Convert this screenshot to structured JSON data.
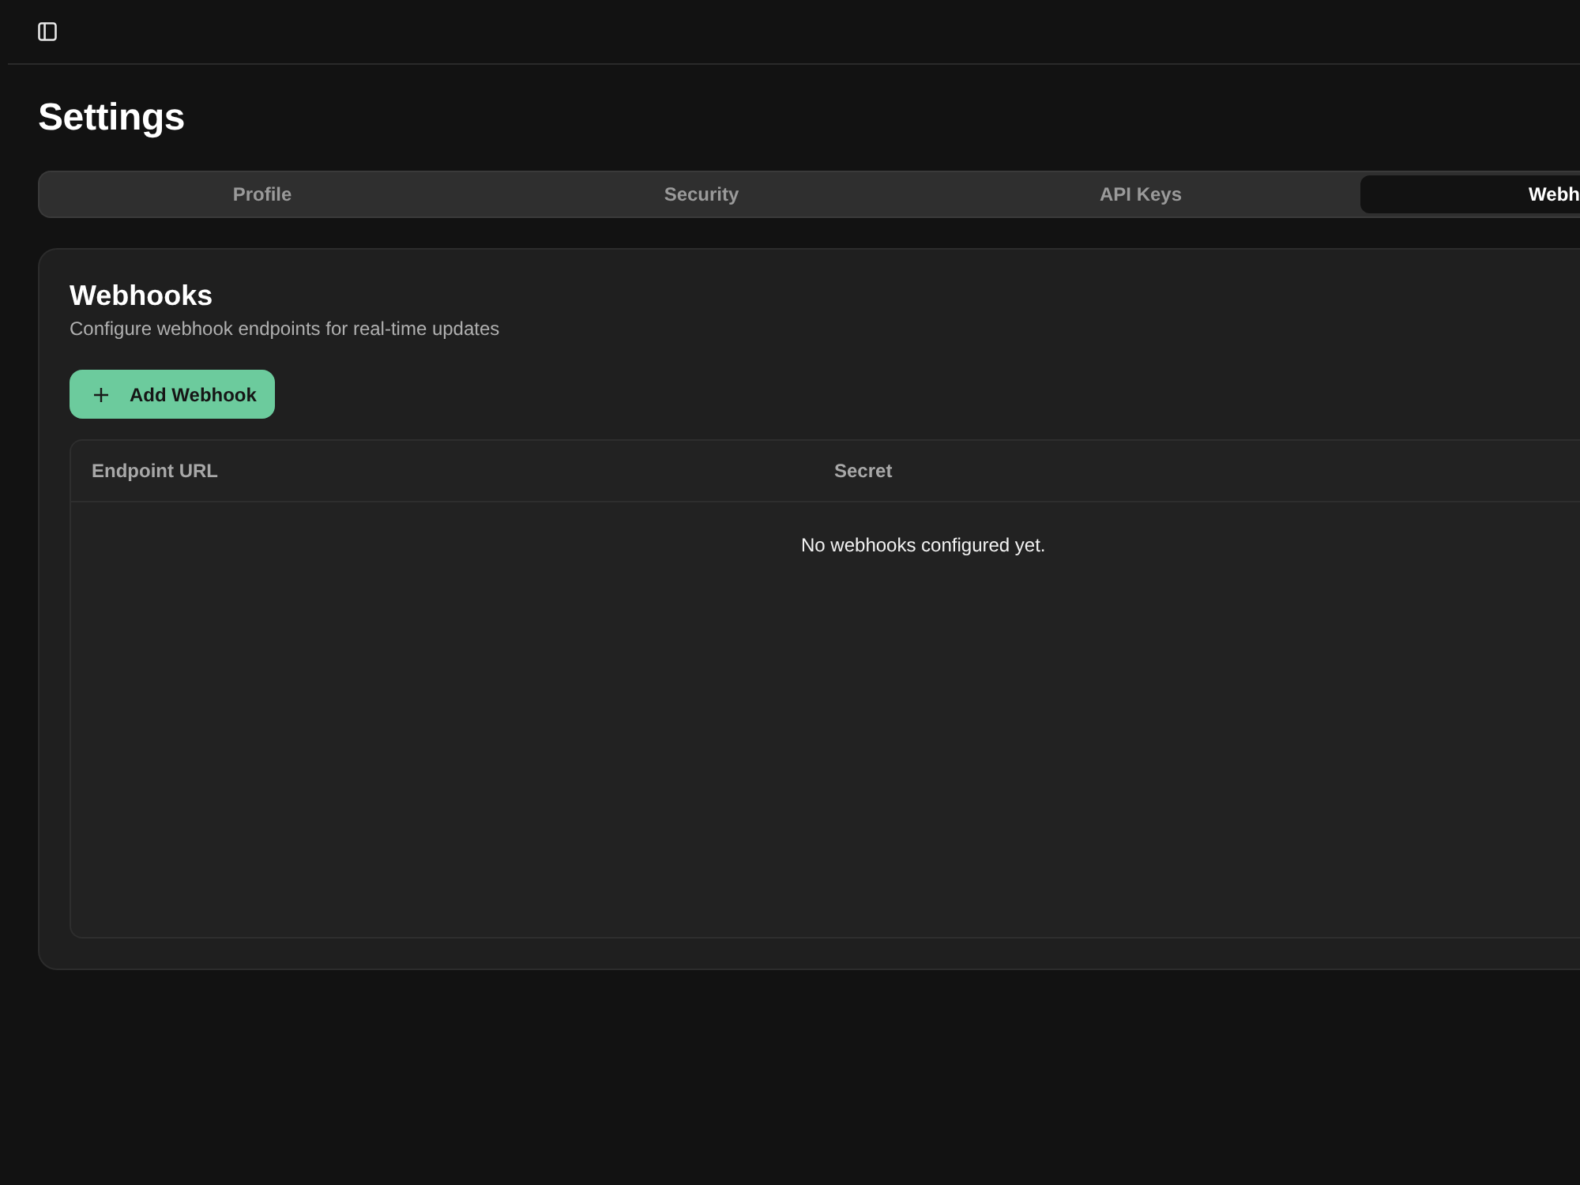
{
  "page": {
    "title": "Settings"
  },
  "tabs": [
    {
      "label": "Profile",
      "selected": false
    },
    {
      "label": "Security",
      "selected": false
    },
    {
      "label": "API Keys",
      "selected": false
    },
    {
      "label": "Webh",
      "selected": true
    }
  ],
  "card": {
    "title": "Webhooks",
    "description": "Configure webhook endpoints for real-time updates",
    "add_button": {
      "label": "Add Webhook"
    },
    "table": {
      "columns": [
        "Endpoint URL",
        "Secret"
      ],
      "empty_message": "No webhooks configured yet."
    }
  }
}
